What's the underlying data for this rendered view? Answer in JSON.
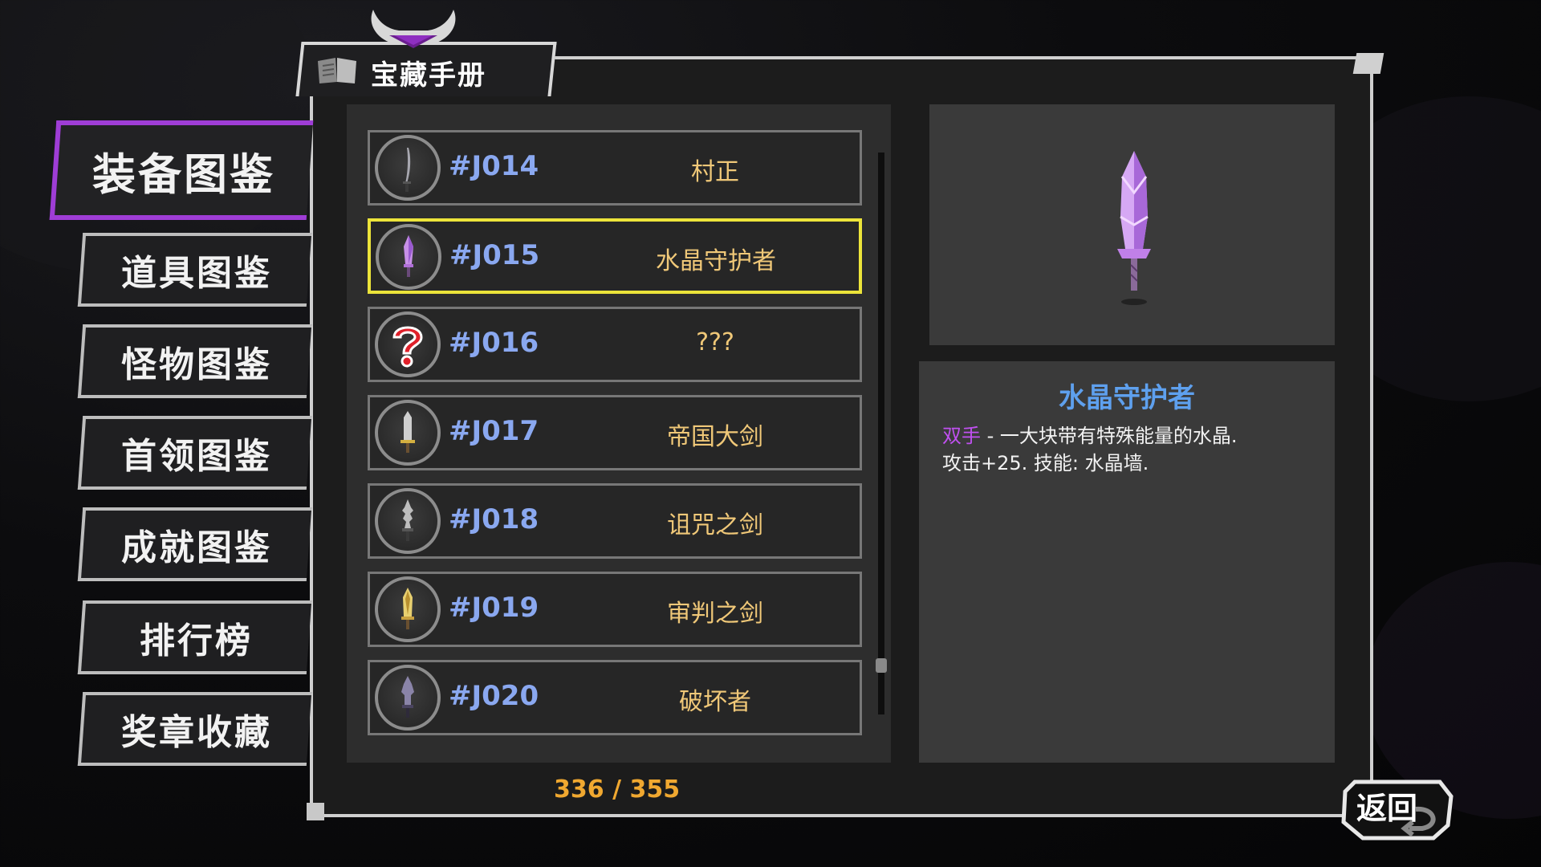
{
  "header": {
    "title": "宝藏手册"
  },
  "menu": {
    "items": [
      {
        "label": "装备图鉴"
      },
      {
        "label": "道具图鉴"
      },
      {
        "label": "怪物图鉴"
      },
      {
        "label": "首领图鉴"
      },
      {
        "label": "成就图鉴"
      },
      {
        "label": "排行榜"
      },
      {
        "label": "奖章收藏"
      }
    ],
    "active_index": 0
  },
  "list": {
    "rows": [
      {
        "code": "#J014",
        "name": "村正",
        "icon": "katana-icon"
      },
      {
        "code": "#J015",
        "name": "水晶守护者",
        "icon": "crystal-sword-icon",
        "selected": true
      },
      {
        "code": "#J016",
        "name": "???",
        "icon": "question-mark-icon"
      },
      {
        "code": "#J017",
        "name": "帝国大剑",
        "icon": "greatsword-icon"
      },
      {
        "code": "#J018",
        "name": "诅咒之剑",
        "icon": "cursed-sword-icon"
      },
      {
        "code": "#J019",
        "name": "审判之剑",
        "icon": "golden-sword-icon"
      },
      {
        "code": "#J020",
        "name": "破坏者",
        "icon": "dark-sword-icon"
      }
    ],
    "progress": "336 / 355"
  },
  "detail": {
    "title": "水晶守护者",
    "tag": "双手",
    "line1": " - 一大块带有特殊能量的水晶.",
    "line2": "攻击+25. 技能: 水晶墙.",
    "icon": "crystal-sword-icon"
  },
  "return_button": {
    "label": "返回"
  },
  "colors": {
    "accent_purple": "#9f3dd6",
    "selected_border": "#ece43a",
    "code_blue": "#8aa8f0",
    "name_gold": "#f0c878",
    "title_blue": "#5ea0ee",
    "progress_orange": "#f0a830"
  }
}
